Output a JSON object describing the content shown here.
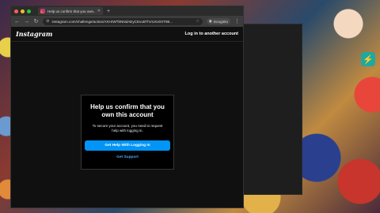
{
  "browser": {
    "tab_title": "Help us confirm that you own...",
    "url": "instagram.com/challenge/action/AXHrWTbNNdAEyCEvu5ThVUXv0XT98...",
    "incognito_label": "Incognito"
  },
  "page": {
    "logo": "Instagram",
    "login_other": "Log in to another account"
  },
  "card": {
    "title": "Help us confirm that you own this account",
    "body": "To secure your account, you need to request help with logging in.",
    "primary_button": "Get Help With Logging In",
    "secondary_link": "Get Support"
  },
  "colors": {
    "accent": "#0095f6",
    "link": "#4da3f7"
  }
}
